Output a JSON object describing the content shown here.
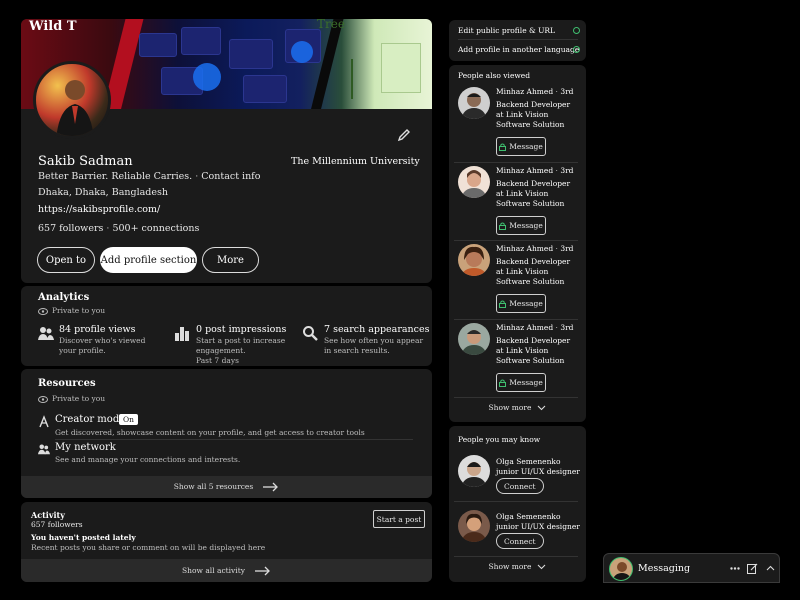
{
  "profile": {
    "name": "Sakib Sadman",
    "headline": "Better Barrier. Reliable Carries.",
    "contact_info": "Contact info",
    "location": "Dhaka, Dhaka, Bangladesh",
    "website": "https://sakibsprofile.com/",
    "followers": "657 followers",
    "connections": "500+ connections",
    "education": "The Millennium University",
    "banner_text": "Wild T",
    "banner_text2": "Tree",
    "buttons": {
      "open_to": "Open to",
      "add_section": "Add profile section",
      "more": "More"
    }
  },
  "analytics": {
    "title": "Analytics",
    "privacy": "Private to you",
    "items": [
      {
        "title": "84 profile views",
        "desc": "Discover who's viewed your profile.",
        "icon": "people-icon"
      },
      {
        "title": "0 post impressions",
        "desc": "Start a post to increase engagement.",
        "sub": "Past 7 days",
        "icon": "bar-chart-icon"
      },
      {
        "title": "7 search appearances",
        "desc": "See how often you appear in search results.",
        "icon": "search-icon"
      }
    ]
  },
  "resources": {
    "title": "Resources",
    "privacy": "Private to you",
    "creator_mode": {
      "title": "Creator mode",
      "badge": "On",
      "desc": "Get discovered, showcase content on your profile, and get access to creator tools"
    },
    "network": {
      "title": "My network",
      "desc": "See and manage your connections and interests."
    },
    "show_all": "Show all 5 resources"
  },
  "activity": {
    "title": "Activity",
    "followers": "657 followers",
    "start_post": "Start a post",
    "empty_title": "You haven't posted lately",
    "empty_desc": "Recent posts you share or comment on will be displayed here",
    "show_all": "Show all activity"
  },
  "sidebar_top": {
    "edit_public": "Edit public profile & URL",
    "add_language": "Add profile in another language"
  },
  "people_also_viewed": {
    "title": "People also viewed",
    "message_label": "Message",
    "show_more": "Show more",
    "people": [
      {
        "name": "Minhaz Ahmed",
        "degree": "3rd",
        "headline": "Backend Developer at Link Vision Software Solution"
      },
      {
        "name": "Minhaz Ahmed",
        "degree": "3rd",
        "headline": "Backend Developer at Link Vision Software Solution"
      },
      {
        "name": "Minhaz Ahmed",
        "degree": "3rd",
        "headline": "Backend Developer at Link Vision Software Solution"
      },
      {
        "name": "Minhaz Ahmed",
        "degree": "3rd",
        "headline": "Backend Developer at Link Vision Software Solution"
      }
    ]
  },
  "people_you_may_know": {
    "title": "People you may know",
    "connect_label": "Connect",
    "show_more": "Show more",
    "people": [
      {
        "name": "Olga Semenenko",
        "headline": "junior UI/UX designer"
      },
      {
        "name": "Olga Semenenko",
        "headline": "junior UI/UX designer"
      }
    ]
  },
  "messaging": {
    "label": "Messaging"
  },
  "colors": {
    "card_bg": "#1b1b1b",
    "page_bg": "#000000",
    "accent_green": "#3fbf6f"
  }
}
